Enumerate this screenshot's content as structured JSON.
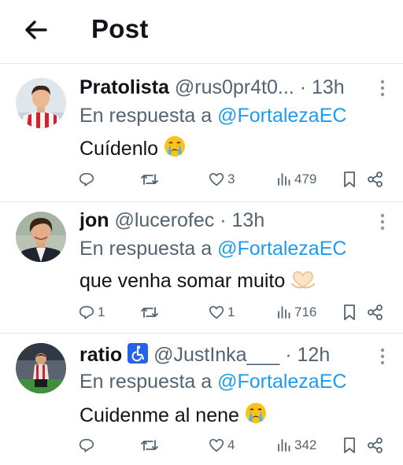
{
  "header": {
    "title": "Post"
  },
  "posts": [
    {
      "name": "Pratolista",
      "handle": "@rus0pr4t0...",
      "time": "· 13h",
      "reply_prefix": "En respuesta a",
      "reply_to": "@FortalezaEC",
      "text": "Cuídenlo",
      "emoji": "crying-face",
      "replies": "",
      "reposts": "",
      "likes": "3",
      "views": "479"
    },
    {
      "name": "jon",
      "handle": "@lucerofec",
      "time": "· 13h",
      "reply_prefix": "En respuesta a",
      "reply_to": "@FortalezaEC",
      "text": "que venha somar muito",
      "emoji": "heart-hands",
      "replies": "1",
      "reposts": "",
      "likes": "1",
      "views": "716"
    },
    {
      "name": "ratio",
      "badge": "wheelchair-symbol",
      "handle": "@JustInka___",
      "time": "· 12h",
      "reply_prefix": "En respuesta a",
      "reply_to": "@FortalezaEC",
      "text": "Cuidenme al nene",
      "emoji": "crying-face",
      "replies": "",
      "reposts": "",
      "likes": "4",
      "views": "342"
    }
  ],
  "colors": {
    "text": "#0f1419",
    "secondary": "#536471",
    "link": "#1d9bf0",
    "divider": "#e3e7ea"
  }
}
